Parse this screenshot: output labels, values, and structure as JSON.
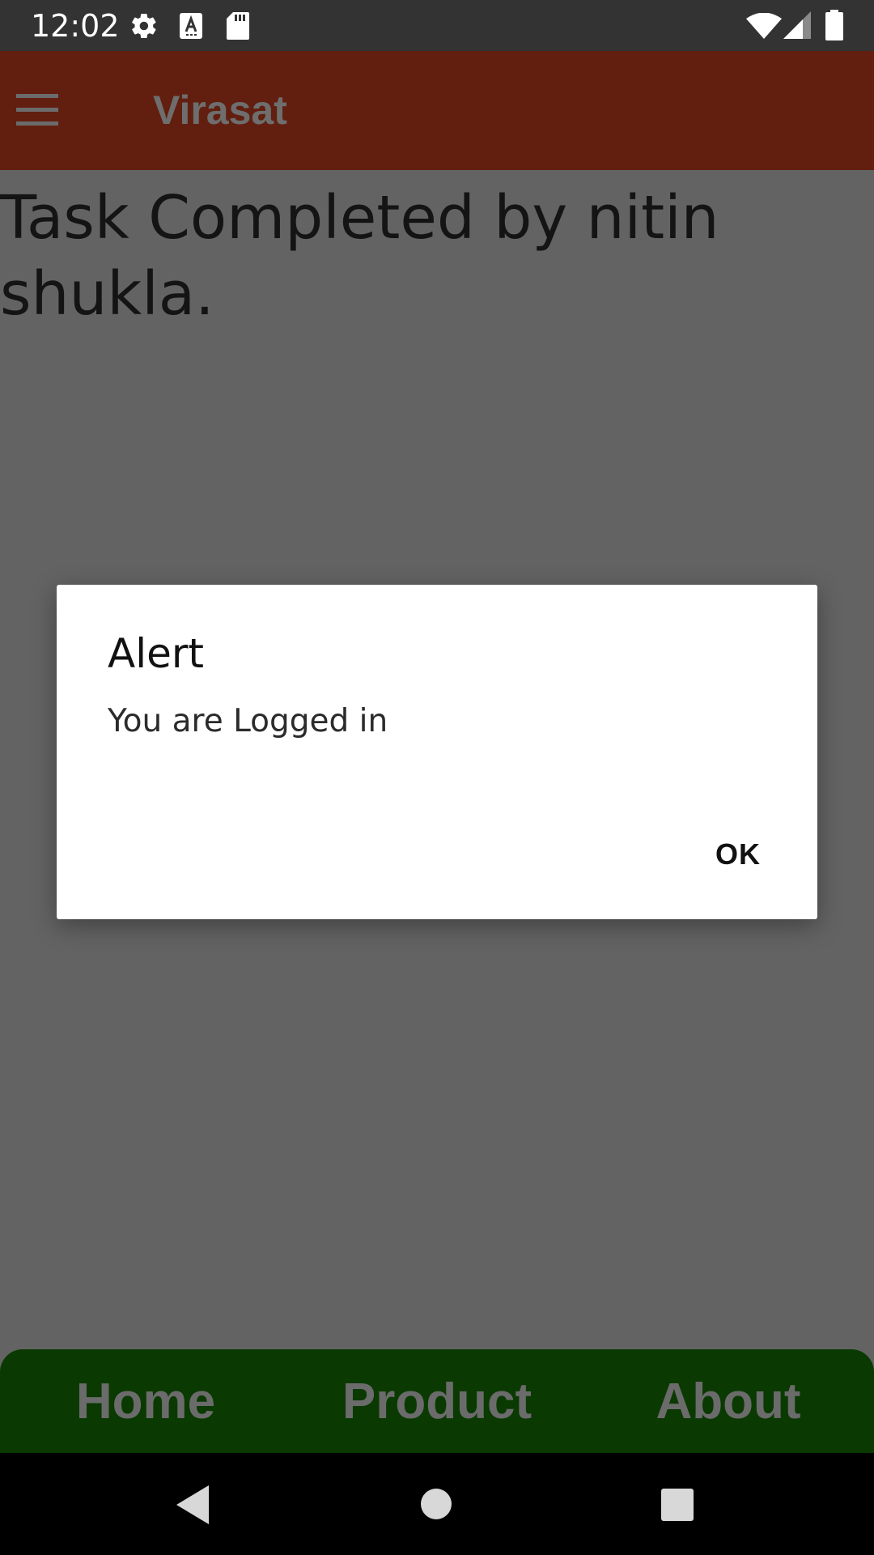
{
  "status_bar": {
    "time": "12:02",
    "icons": [
      "gear-icon",
      "a-box-icon",
      "sd-card-icon",
      "wifi-icon",
      "signal-icon",
      "battery-icon"
    ]
  },
  "app_bar": {
    "title": "Virasat",
    "menu_icon": "hamburger-menu-icon"
  },
  "main": {
    "message": "Task Completed by nitin shukla."
  },
  "dialog": {
    "title": "Alert",
    "message": "You are Logged in",
    "ok_label": "OK"
  },
  "bottom_nav": {
    "items": [
      {
        "label": "Home"
      },
      {
        "label": "Product"
      },
      {
        "label": "About"
      }
    ]
  },
  "system_nav": {
    "icons": [
      "back-icon",
      "home-circle-icon",
      "recents-square-icon"
    ]
  },
  "colors": {
    "app_bar": "#621f10",
    "bottom_nav": "#0a3a02",
    "scrim": "#636363",
    "status_bar": "#333333"
  }
}
